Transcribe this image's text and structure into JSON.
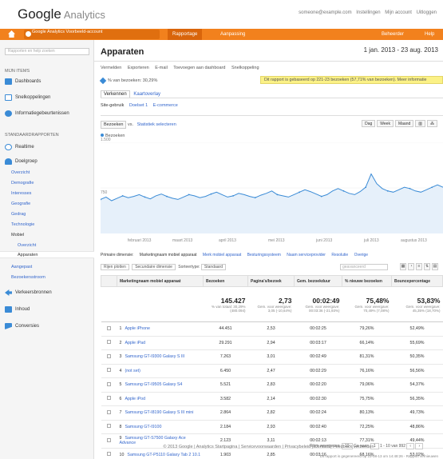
{
  "header": {
    "logo_google": "Google",
    "logo_product": "Analytics",
    "links": [
      "someone@example.com",
      "Instellingen",
      "Mijn account",
      "Uitloggen"
    ]
  },
  "nav": {
    "account": "Google Analytics Voorbeeld-account",
    "tabs": [
      "Rapportage",
      "Aanpassing"
    ],
    "right": [
      "Beheerder",
      "Help"
    ]
  },
  "sidebar": {
    "search_placeholder": "Rapporten en help zoeken",
    "sec1": "MIJN ITEMS",
    "items_top": [
      "Dashboards",
      "Snelkoppelingen",
      "Informatiegebeurtenissen"
    ],
    "sec2": "STANDAARDRAPPORTEN",
    "items_std": [
      "Realtime",
      "Doelgroep"
    ],
    "subitems": [
      "Overzicht",
      "Demografie",
      "Interesses",
      "Geografie",
      "Gedrag",
      "Technologie",
      "Mobiel",
      "Overzicht",
      "Apparaten",
      "Aangepast",
      "Bezoekersstroom"
    ],
    "items_bottom": [
      "Verkeersbronnen",
      "Inhoud",
      "Conversies"
    ]
  },
  "main": {
    "title": "Apparaten",
    "daterange": "1 jan. 2013 - 23 aug. 2013",
    "toolbar": [
      "Vermelden",
      "Exporteren",
      "E-mail",
      "Toevoegen aan dashboard",
      "Snelkoppeling"
    ],
    "segment": "% van bezoeken: 30,29%",
    "notice": "Dit rapport is gebaseerd op 221-23 bezoeken (57,71% van bezoeken). Meer informatie",
    "subtabs": [
      "Verkennen",
      "Kaartoverlay"
    ],
    "subtabs2": [
      "Site-gebruik",
      "Doelset 1",
      "E-commerce"
    ],
    "ctrl_select": "Bezoeken",
    "ctrl_vs": "vs.",
    "ctrl_link": "Statistiek selecteren",
    "btns": [
      "Dag",
      "Week",
      "Maand"
    ],
    "legend": "Bezoeken",
    "ymax": "1.500",
    "ymid": "750",
    "xticks": [
      "februari 2013",
      "maart 2013",
      "april 2013",
      "mei 2013",
      "juni 2013",
      "juli 2013",
      "augustus 2013"
    ],
    "dims": [
      "Primaire dimensie:",
      "Marketingnaam mobiel apparaat",
      "Merk mobiel apparaat",
      "Besturingssysteem",
      "Naam serviceprovider",
      "Resolutie",
      "Overige"
    ],
    "filter_plot": "Rijen plotten",
    "filter_sec": "Secundaire dimensie",
    "filter_sort": "Sorteertype:",
    "filter_sort_val": "Standaard",
    "search_ph": "geavanceerd",
    "footer": "© 2013 Google | Analytics Startpagina | Servicevoorwaarden | Privacybeleid | Contact | Feedback verzenden"
  },
  "table": {
    "cols": [
      "Marketingnaam mobiel apparaat",
      "Bezoeken",
      "Pagina's/bezoek",
      "Gem. bezoekduur",
      "% nieuwe bezoeken",
      "Bouncepercentage"
    ],
    "totals": {
      "visits": "145.427",
      "visits_sub": "% van totaal: 30,29% (480.094)",
      "pps": "2,73",
      "pps_sub": "Gem. voor weergave: 3,05 (-10,64%)",
      "dur": "00:02:49",
      "dur_sub": "Gem. voor weergave: 00:03:36 (-21,93%)",
      "newv": "75,48%",
      "newv_sub": "Gem. voor weergave: 70,49% (7,08%)",
      "bounce": "53,83%",
      "bounce_sub": "Gem. voor weergave: 45,35% (18,70%)"
    },
    "rows": [
      {
        "n": "1",
        "name": "Apple iPhone",
        "v": "44.451",
        "p": "2,53",
        "d": "00:02:25",
        "nv": "79,26%",
        "b": "52,49%"
      },
      {
        "n": "2",
        "name": "Apple iPad",
        "v": "29.291",
        "p": "2,94",
        "d": "00:03:17",
        "nv": "66,14%",
        "b": "55,69%"
      },
      {
        "n": "3",
        "name": "Samsung GT-I9300 Galaxy S III",
        "v": "7.263",
        "p": "3,01",
        "d": "00:02:49",
        "nv": "81,31%",
        "b": "50,35%"
      },
      {
        "n": "4",
        "name": "(not set)",
        "v": "6.450",
        "p": "2,47",
        "d": "00:02:29",
        "nv": "76,16%",
        "b": "56,56%"
      },
      {
        "n": "5",
        "name": "Samsung GT-I9505 Galaxy S4",
        "v": "5.521",
        "p": "2,83",
        "d": "00:02:20",
        "nv": "79,06%",
        "b": "54,37%"
      },
      {
        "n": "6",
        "name": "Apple iPod",
        "v": "3.582",
        "p": "2,14",
        "d": "00:02:30",
        "nv": "75,75%",
        "b": "56,35%"
      },
      {
        "n": "7",
        "name": "Samsung GT-I8190 Galaxy S III mini",
        "v": "2.864",
        "p": "2,82",
        "d": "00:02:24",
        "nv": "80,13%",
        "b": "49,73%"
      },
      {
        "n": "8",
        "name": "Samsung GT-I9100",
        "v": "2.184",
        "p": "2,93",
        "d": "00:02:40",
        "nv": "72,25%",
        "b": "48,86%"
      },
      {
        "n": "9",
        "name": "Samsung GT-S7500 Galaxy Ace Advance",
        "v": "2.123",
        "p": "3,11",
        "d": "00:02:13",
        "nv": "77,31%",
        "b": "49,44%"
      },
      {
        "n": "10",
        "name": "Samsung GT-P5110 Galaxy Tab 2 10.1",
        "v": "1.903",
        "p": "2,85",
        "d": "00:03:16",
        "nv": "68,16%",
        "b": "53,02%"
      }
    ]
  },
  "pagination": {
    "label_rows": "Rijen weergeven:",
    "rows": "10",
    "label_goto": "Ga naar:",
    "goto": "1",
    "range": "1 - 10 van 992"
  },
  "pnote": "Dit rapport is gegenereerd op 23-08-13 om 14:48:26 - Rapport vernieuwen",
  "chart_data": {
    "type": "line",
    "title": "",
    "series": [
      {
        "name": "Bezoeken",
        "values": [
          560,
          600,
          540,
          580,
          620,
          590,
          610,
          640,
          600,
          570,
          620,
          650,
          610,
          580,
          560,
          600,
          640,
          620,
          590,
          610,
          650,
          680,
          640,
          600,
          620,
          660,
          640,
          610,
          590,
          630,
          660,
          700,
          640,
          620,
          600,
          640,
          680,
          720,
          690,
          650,
          610,
          640,
          700,
          740,
          700,
          660,
          640,
          690,
          760,
          980,
          820,
          740,
          700,
          680,
          720,
          760,
          740,
          700,
          680,
          720,
          760,
          800,
          760
        ]
      }
    ],
    "ylim": [
      0,
      1500
    ],
    "ylabel": "",
    "xlabel": "",
    "accent": "#3a8bd6"
  }
}
